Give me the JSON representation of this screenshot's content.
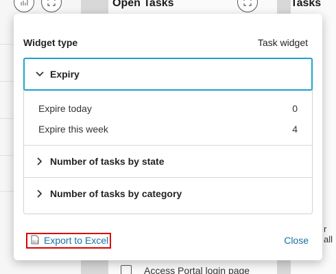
{
  "background": {
    "open_tasks_title": "Open Tasks",
    "right_title": "Tasks",
    "bottom_link": "Access Portal login page",
    "side_text": "r all"
  },
  "dialog": {
    "widget_type_label": "Widget type",
    "widget_type_value": "Task widget",
    "sections": [
      {
        "label": "Expiry",
        "expanded": true,
        "rows": [
          {
            "label": "Expire today",
            "value": "0"
          },
          {
            "label": "Expire this week",
            "value": "4"
          }
        ]
      },
      {
        "label": "Number of tasks by state",
        "expanded": false
      },
      {
        "label": "Number of tasks by category",
        "expanded": false
      }
    ],
    "export_label": "Export to Excel",
    "close_label": "Close"
  },
  "colors": {
    "accent": "#1fa0c8",
    "link": "#1a6fa0",
    "highlight_border": "#d90000"
  }
}
